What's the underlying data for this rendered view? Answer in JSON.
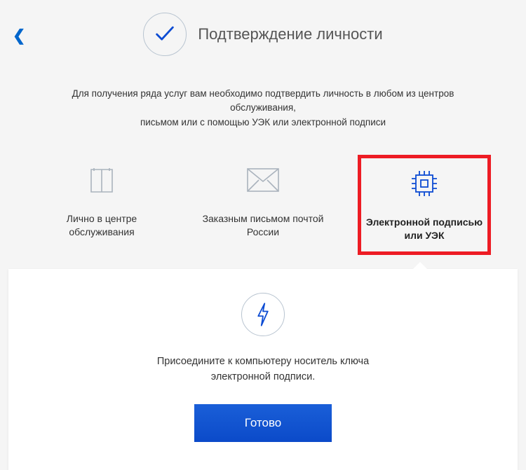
{
  "header": {
    "title": "Подтверждение личности"
  },
  "subtitle_line1": "Для получения ряда услуг вам необходимо подтвердить личность в любом из центров обслуживания,",
  "subtitle_line2": "письмом или с помощью УЭК или электронной подписи",
  "options": {
    "center": "Лично в центре обслуживания",
    "mail": "Заказным письмом почтой России",
    "esign": "Электронной подписью или УЭК"
  },
  "panel": {
    "instruction_line1": "Присоедините к компьютеру носитель ключа",
    "instruction_line2": "электронной подписи.",
    "button": "Готово"
  }
}
